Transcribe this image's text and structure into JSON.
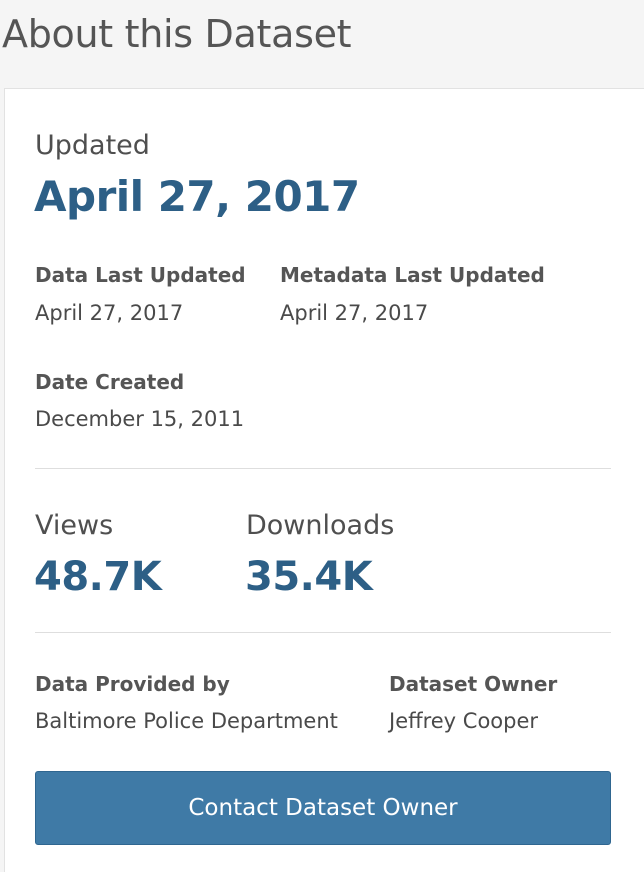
{
  "page": {
    "title": "About this Dataset"
  },
  "updated": {
    "label": "Updated",
    "value": "April 27, 2017"
  },
  "dates": {
    "data_last_updated": {
      "label": "Data Last Updated",
      "value": "April 27, 2017"
    },
    "metadata_last_updated": {
      "label": "Metadata Last Updated",
      "value": "April 27, 2017"
    },
    "date_created": {
      "label": "Date Created",
      "value": "December 15, 2011"
    }
  },
  "stats": {
    "views": {
      "label": "Views",
      "value": "48.7K"
    },
    "downloads": {
      "label": "Downloads",
      "value": "35.4K"
    }
  },
  "attribution": {
    "provided_by": {
      "label": "Data Provided by",
      "value": "Baltimore Police Department"
    },
    "owner": {
      "label": "Dataset Owner",
      "value": "Jeffrey Cooper"
    }
  },
  "actions": {
    "contact_owner_label": "Contact Dataset Owner"
  },
  "colors": {
    "accent": "#2d5f86",
    "button": "#3f7aa6",
    "background": "#f5f5f5"
  }
}
